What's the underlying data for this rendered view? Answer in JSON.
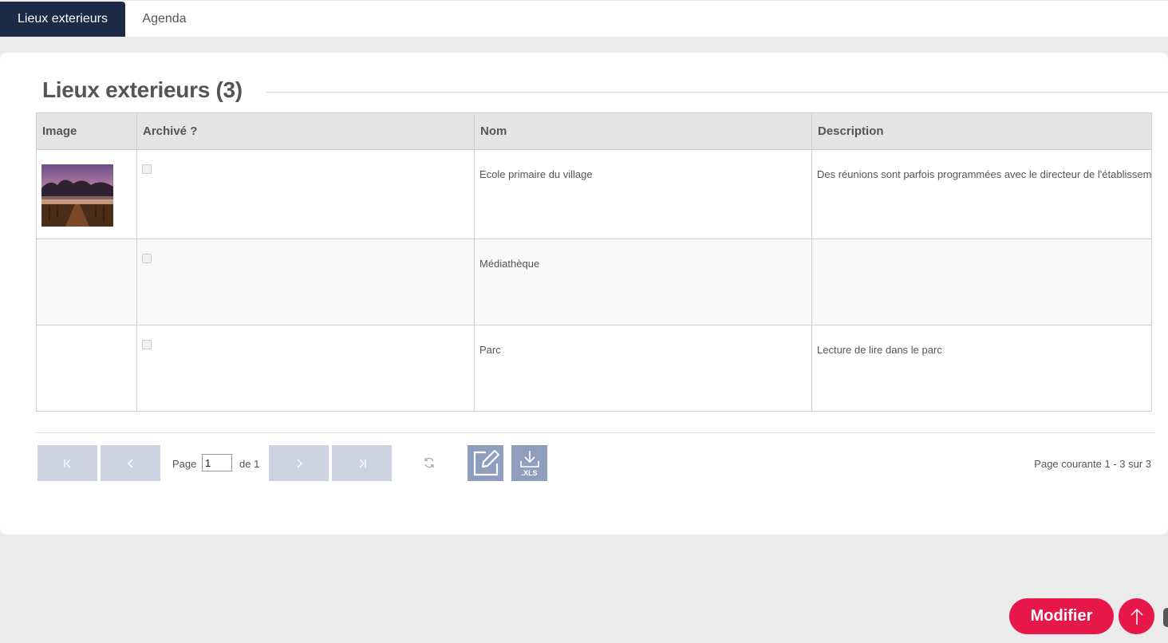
{
  "tabs": [
    {
      "label": "Lieux exterieurs",
      "active": true
    },
    {
      "label": "Agenda",
      "active": false
    }
  ],
  "section": {
    "title": "Lieux exterieurs (3)"
  },
  "table": {
    "headers": [
      "Image",
      "Archivé ?",
      "Nom",
      "Description"
    ],
    "rows": [
      {
        "has_image": true,
        "archived": false,
        "nom": "Ecole primaire du village",
        "description": "Des réunions sont parfois programmées avec le directeur de l'établissement"
      },
      {
        "has_image": false,
        "archived": false,
        "nom": "Médiathèque",
        "description": ""
      },
      {
        "has_image": false,
        "archived": false,
        "nom": "Parc",
        "description": "Lecture de lire dans le parc"
      }
    ]
  },
  "pager": {
    "page_label": "Page",
    "current_page": "1",
    "of_label": "de 1",
    "summary": "Page courante 1 - 3 sur 3",
    "export_label": ".XLS"
  },
  "actions": {
    "modifier_label": "Modifier"
  },
  "colors": {
    "tab_active": "#1b2a45",
    "pager_button": "#cdd3e3",
    "tool_button": "#8f9dbf",
    "accent": "#e8174a"
  },
  "icons": {
    "first": "first-page-icon",
    "prev": "previous-page-icon",
    "next": "next-page-icon",
    "last": "last-page-icon",
    "refresh": "refresh-icon",
    "edit": "edit-icon",
    "export": "xls-download-icon",
    "scroll_top": "arrow-up-icon"
  }
}
